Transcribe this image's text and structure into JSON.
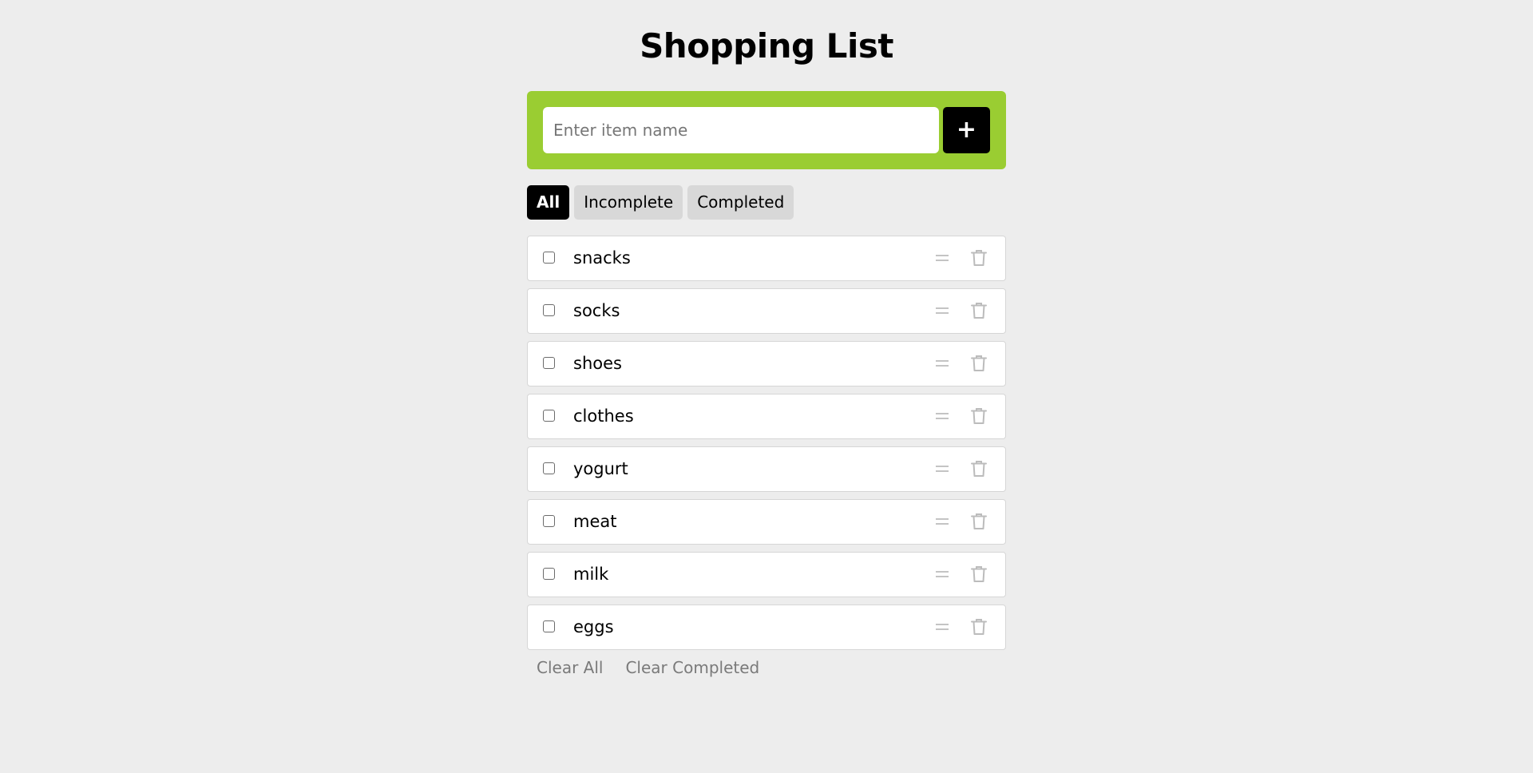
{
  "header": {
    "title": "Shopping List"
  },
  "add_form": {
    "placeholder": "Enter item name",
    "value": "",
    "add_button_label": "+",
    "panel_color": "#9acd32"
  },
  "filters": {
    "tabs": [
      {
        "label": "All",
        "active": true
      },
      {
        "label": "Incomplete",
        "active": false
      },
      {
        "label": "Completed",
        "active": false
      }
    ]
  },
  "items": [
    {
      "name": "snacks",
      "checked": false
    },
    {
      "name": "socks",
      "checked": false
    },
    {
      "name": "shoes",
      "checked": false
    },
    {
      "name": "clothes",
      "checked": false
    },
    {
      "name": "yogurt",
      "checked": false
    },
    {
      "name": "meat",
      "checked": false
    },
    {
      "name": "milk",
      "checked": false
    },
    {
      "name": "eggs",
      "checked": false
    }
  ],
  "item_icons": {
    "drag": "drag-handle-icon",
    "delete": "trash-icon"
  },
  "footer": {
    "clear_all_label": "Clear All",
    "clear_completed_label": "Clear Completed"
  }
}
